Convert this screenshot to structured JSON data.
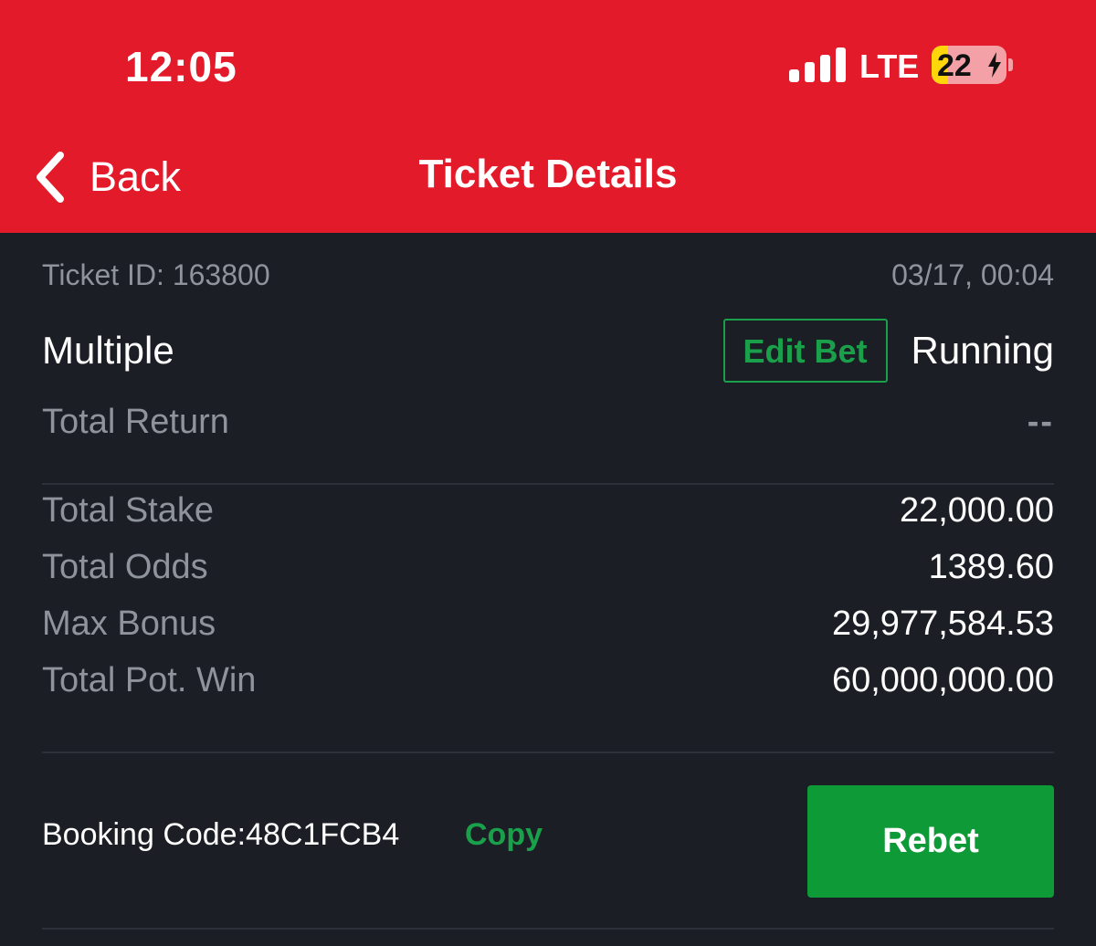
{
  "status_bar": {
    "time": "12:05",
    "network": "LTE",
    "battery": "22",
    "battery_level": 0.22
  },
  "nav": {
    "back_label": "Back",
    "title": "Ticket Details"
  },
  "ticket": {
    "id_text": "Ticket ID: 163800",
    "datetime": "03/17, 00:04",
    "bet_type": "Multiple",
    "edit_bet_label": "Edit Bet",
    "status": "Running",
    "total_return_label": "Total Return",
    "total_return_value": "--",
    "total_stake_label": "Total Stake",
    "total_stake_value": "22,000.00",
    "total_odds_label": "Total Odds",
    "total_odds_value": "1389.60",
    "max_bonus_label": "Max Bonus",
    "max_bonus_value": "29,977,584.53",
    "total_pot_win_label": "Total Pot. Win",
    "total_pot_win_value": "60,000,000.00",
    "booking_code_text": "Booking Code:48C1FCB4",
    "copy_label": "Copy",
    "rebet_label": "Rebet"
  },
  "colors": {
    "header_red": "#e31a2a",
    "accent_green": "#1aa04b",
    "button_green": "#0e9a37",
    "background": "#1b1e24"
  }
}
